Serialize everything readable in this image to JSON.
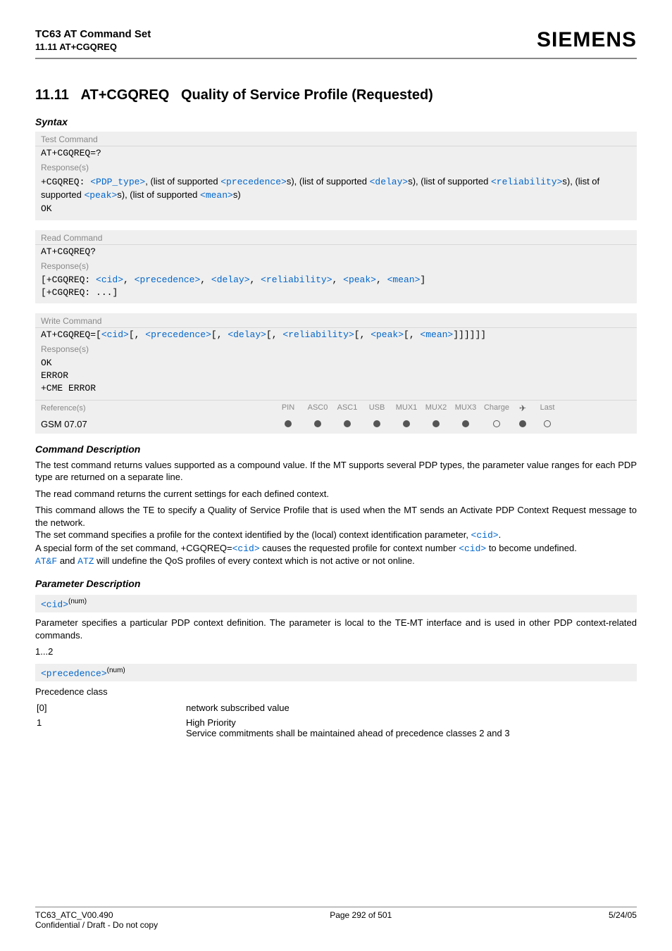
{
  "header": {
    "title": "TC63 AT Command Set",
    "sub": "11.11 AT+CGQREQ",
    "brand": "SIEMENS"
  },
  "section": {
    "number": "11.11",
    "command": "AT+CGQREQ",
    "title": "Quality of Service Profile (Requested)"
  },
  "syntax_heading": "Syntax",
  "blocks": {
    "test": {
      "label": "Test Command",
      "cmd": "AT+CGQREQ=?",
      "resp_label": "Response(s)",
      "line_prefix": "+CGQREQ: ",
      "parts": {
        "p1": "<PDP_type>",
        "t1": ", (list of supported ",
        "p2": "<precedence>",
        "t2": "s), (list of supported ",
        "p3": "<delay>",
        "t3": "s), (list of supported ",
        "p4": "<reliability>",
        "t4": "s), (list of supported ",
        "p5": "<peak>",
        "t5": "s), (list of supported ",
        "p6": "<mean>",
        "t6": "s)"
      },
      "ok": "OK"
    },
    "read": {
      "label": "Read Command",
      "cmd": "AT+CGQREQ?",
      "resp_label": "Response(s)",
      "line_open": "[",
      "line_prefix": "+CGQREQ: ",
      "p1": "<cid>",
      "p2": "<precedence>",
      "p3": "<delay>",
      "p4": "<reliability>",
      "p5": "<peak>",
      "p6": "<mean>",
      "close": "]",
      "sep": ", ",
      "line2_open": "[",
      "line2": "+CGQREQ: ...",
      "line2_close": "]"
    },
    "write": {
      "label": "Write Command",
      "cmd_prefix": "AT+CGQREQ=",
      "lb": "[",
      "rb": "]]]]]]",
      "sep": ", ",
      "p1": "<cid>",
      "p2": "<precedence>",
      "p3": "<delay>",
      "p4": "<reliability>",
      "p5": "<peak>",
      "p6": "<mean>",
      "resp_label": "Response(s)",
      "r1": "OK",
      "r2": "ERROR",
      "r3": "+CME ERROR"
    },
    "ref": {
      "label": "Reference(s)",
      "cols": [
        "PIN",
        "ASC0",
        "ASC1",
        "USB",
        "MUX1",
        "MUX2",
        "MUX3",
        "Charge",
        "✈",
        "Last"
      ],
      "value": "GSM 07.07",
      "dots": [
        "filled",
        "filled",
        "filled",
        "filled",
        "filled",
        "filled",
        "filled",
        "empty",
        "filled",
        "empty"
      ]
    }
  },
  "cmd_desc_heading": "Command Description",
  "cmd_desc": {
    "p1": "The test command returns values supported as a compound value. If the MT supports several PDP types, the parameter value ranges for each PDP type are returned on a separate line.",
    "p2": "The read command returns the current settings for each defined context.",
    "p3": "This command allows the TE to specify a Quality of Service Profile that is used when the MT sends an Activate PDP Context Request message to the network.",
    "p4_a": "The set command specifies a profile for the context identified by the (local) context identification parameter, ",
    "p4_cid": "<cid>",
    "p4_b": ".",
    "p5_a": "A special form of the set command, +CGQREQ=",
    "p5_cid1": "<cid>",
    "p5_b": " causes the requested profile for context number ",
    "p5_cid2": "<cid>",
    "p5_c": " to become undefined.",
    "p6_a": "AT&F",
    "p6_b": " and ",
    "p6_c": "ATZ",
    "p6_d": " will undefine the QoS profiles of every context which is not active or not online."
  },
  "param_heading": "Parameter Description",
  "params": {
    "cid": {
      "name": "<cid>",
      "type": "(num)",
      "desc": "Parameter specifies a particular PDP context definition. The parameter is local to the TE-MT interface and is used in other PDP context-related commands.",
      "range": "1...2"
    },
    "precedence": {
      "name": "<precedence>",
      "type": "(num)",
      "title": "Precedence class",
      "rows": [
        {
          "key": "[0]",
          "val": "network subscribed value"
        },
        {
          "key": "1",
          "val": "High Priority\nService commitments shall be maintained ahead of precedence classes 2 and 3"
        }
      ]
    }
  },
  "footer": {
    "left1": "TC63_ATC_V00.490",
    "left2": "Confidential / Draft - Do not copy",
    "center": "Page 292 of 501",
    "right": "5/24/05"
  }
}
